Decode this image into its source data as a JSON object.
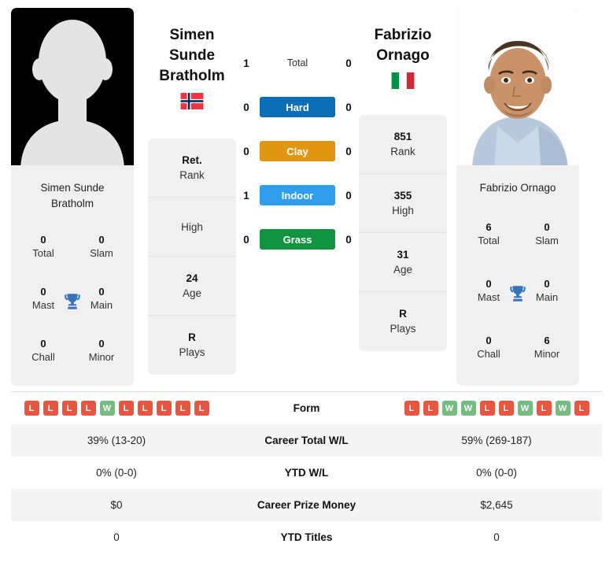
{
  "players": {
    "left": {
      "name_line1": "Simen Sunde",
      "name_line2": "Bratholm",
      "full_name": "Simen Sunde Bratholm",
      "flag": "norway-flag",
      "photo": "silhouette-avatar",
      "rank": "Ret.",
      "rank_label": "Rank",
      "high": "",
      "high_label": "High",
      "age": "24",
      "age_label": "Age",
      "plays": "R",
      "plays_label": "Plays",
      "titles": {
        "total": "0",
        "total_label": "Total",
        "slam": "0",
        "slam_label": "Slam",
        "mast": "0",
        "mast_label": "Mast",
        "main": "0",
        "main_label": "Main",
        "chall": "0",
        "chall_label": "Chall",
        "minor": "0",
        "minor_label": "Minor"
      },
      "form": [
        "L",
        "L",
        "L",
        "L",
        "W",
        "L",
        "L",
        "L",
        "L",
        "L"
      ],
      "career_wl": "39% (13-20)",
      "ytd_wl": "0% (0-0)",
      "prize_money": "$0",
      "ytd_titles": "0"
    },
    "right": {
      "name_line1": "Fabrizio",
      "name_line2": "Ornago",
      "full_name": "Fabrizio Ornago",
      "flag": "italy-flag",
      "photo": "player-portrait",
      "rank": "851",
      "rank_label": "Rank",
      "high": "355",
      "high_label": "High",
      "age": "31",
      "age_label": "Age",
      "plays": "R",
      "plays_label": "Plays",
      "titles": {
        "total": "6",
        "total_label": "Total",
        "slam": "0",
        "slam_label": "Slam",
        "mast": "0",
        "mast_label": "Mast",
        "main": "0",
        "main_label": "Main",
        "chall": "0",
        "chall_label": "Chall",
        "minor": "6",
        "minor_label": "Minor"
      },
      "form": [
        "L",
        "L",
        "W",
        "W",
        "L",
        "L",
        "W",
        "L",
        "W",
        "L"
      ],
      "career_wl": "59% (269-187)",
      "ytd_wl": "0% (0-0)",
      "prize_money": "$2,645",
      "ytd_titles": "0"
    }
  },
  "head_to_head": [
    {
      "label": "Total",
      "left": "1",
      "right": "0",
      "color": ""
    },
    {
      "label": "Hard",
      "left": "0",
      "right": "0",
      "color": "#0c6eb4"
    },
    {
      "label": "Clay",
      "left": "0",
      "right": "0",
      "color": "#e09611"
    },
    {
      "label": "Indoor",
      "left": "1",
      "right": "0",
      "color": "#2f9eeb"
    },
    {
      "label": "Grass",
      "left": "0",
      "right": "0",
      "color": "#119441"
    }
  ],
  "table": {
    "rows": [
      {
        "label": "Form",
        "type": "form"
      },
      {
        "label": "Career Total W/L",
        "type": "text",
        "left_key": "career_wl",
        "right_key": "career_wl"
      },
      {
        "label": "YTD W/L",
        "type": "text",
        "left_key": "ytd_wl",
        "right_key": "ytd_wl"
      },
      {
        "label": "Career Prize Money",
        "type": "text",
        "left_key": "prize_money",
        "right_key": "prize_money"
      },
      {
        "label": "YTD Titles",
        "type": "text",
        "left_key": "ytd_titles",
        "right_key": "ytd_titles"
      }
    ]
  },
  "colors": {
    "win_badge": "#76bb7f",
    "loss_badge": "#e8563f",
    "trophy": "#3a72b8",
    "card_bg": "#f0f0f0",
    "row_alt": "#f4f4f4"
  }
}
